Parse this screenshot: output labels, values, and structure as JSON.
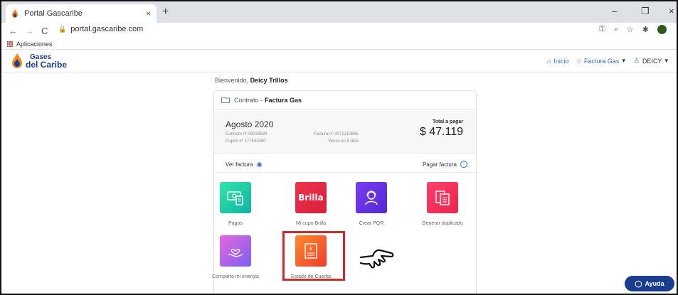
{
  "browser": {
    "tab_title": "Portal Gascaribe",
    "tab_close": "×",
    "new_tab": "+",
    "minimize": "–",
    "restore": "❐",
    "close": "×",
    "url": "portal.gascaribe.com",
    "bookmark_apps": "Aplicaciones"
  },
  "site": {
    "logo_line1": "Gases",
    "logo_line2": "del Caribe",
    "nav": {
      "inicio": "Inicio",
      "factura": "Factura Gas",
      "user": "DEICY"
    }
  },
  "welcome": {
    "prefix": "Bienvenido,",
    "name": "Deicy Trillos"
  },
  "card": {
    "header_prefix": "Contrato -",
    "header_title": "Factura Gas",
    "month": "Agosto 2020",
    "contract": "Contrato nº 48233924",
    "coupon": "Cupón nº 177533480",
    "invoice": "Factura nº 2071310865",
    "due": "Vence en 9 días",
    "total_label": "Total a pagar",
    "total_amount": "$ 47.119",
    "view_invoice": "Ver factura",
    "pay_invoice": "Pagar factura"
  },
  "tiles": [
    {
      "label": "Pagos",
      "icon": "money-icon"
    },
    {
      "label": "Mi cupo Brilla",
      "icon_text": "Brilla"
    },
    {
      "label": "Crear PQR",
      "icon": "support-agent-icon"
    },
    {
      "label": "Generar duplicado",
      "icon": "duplicate-invoice-icon"
    },
    {
      "label": "Comparto mi energía",
      "icon": "heart-hand-icon"
    },
    {
      "label": "Estado de Cuenta",
      "icon": "account-statement-icon"
    }
  ],
  "colors": {
    "brand": "#1a3e8f",
    "highlight": "#d9262c",
    "link": "#2e62c8"
  },
  "help_button": "Ayuda"
}
